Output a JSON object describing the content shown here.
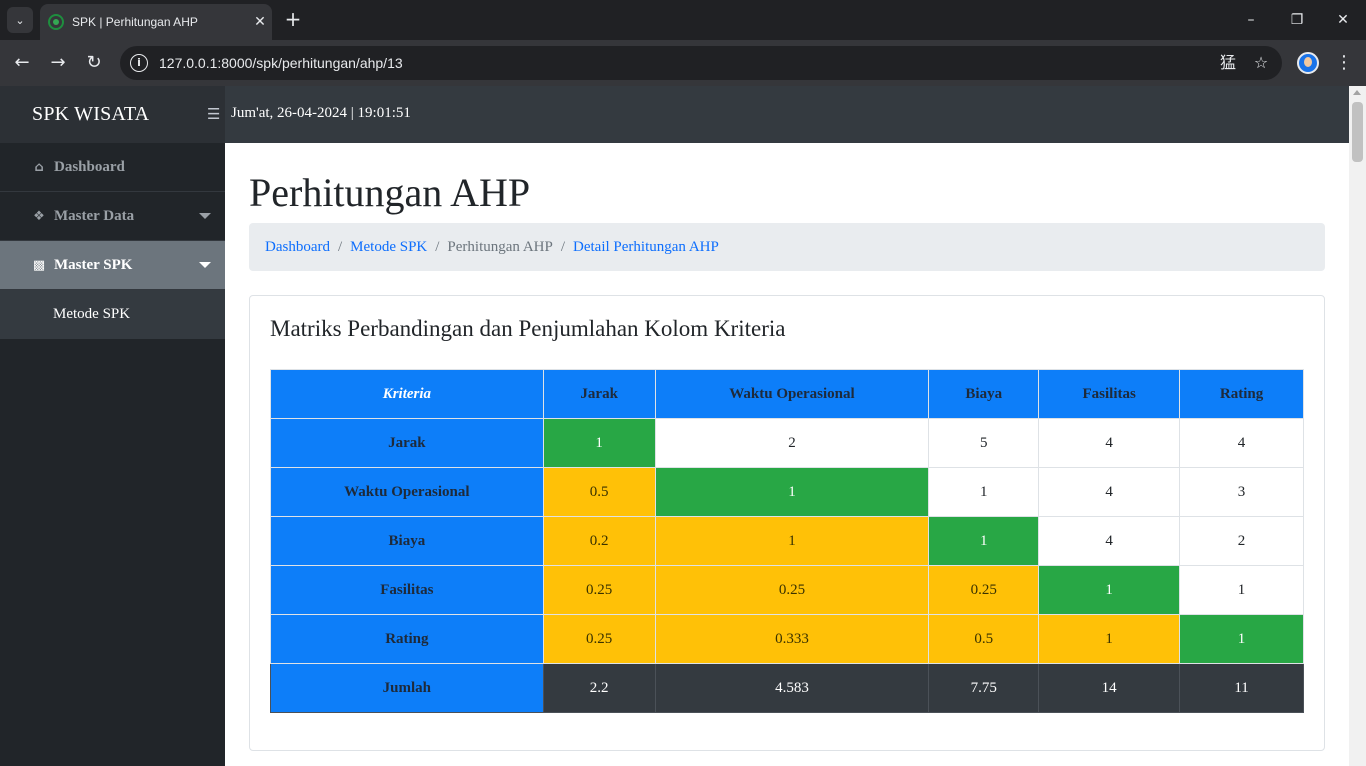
{
  "browser": {
    "tab_title": "SPK | Perhitungan AHP",
    "url": "127.0.0.1:8000/spk/perhitungan/ahp/13",
    "tab_list_icon": "chevron-down-icon",
    "new_tab_icon": "plus-icon"
  },
  "app": {
    "brand": "SPK WISATA",
    "datetime": "Jum'at, 26-04-2024 | 19:01:51"
  },
  "sidebar": {
    "items": [
      {
        "label": "Dashboard",
        "icon": "home-icon"
      },
      {
        "label": "Master Data",
        "icon": "cubes-icon"
      },
      {
        "label": "Master SPK",
        "icon": "sitemap-icon",
        "active": true
      }
    ],
    "sub_items": [
      {
        "label": "Metode SPK"
      }
    ]
  },
  "page": {
    "title": "Perhitungan AHP",
    "breadcrumb": [
      "Dashboard",
      "Metode SPK",
      "Perhitungan AHP",
      "Detail Perhitungan AHP"
    ]
  },
  "card": {
    "title": "Matriks Perbandingan dan Penjumlahan Kolom Kriteria"
  },
  "matrix": {
    "corner_header": "Kriteria",
    "columns": [
      "Jarak",
      "Waktu Operasional",
      "Biaya",
      "Fasilitas",
      "Rating"
    ],
    "rows": [
      {
        "name": "Jarak",
        "values": [
          "1",
          "2",
          "5",
          "4",
          "4"
        ]
      },
      {
        "name": "Waktu Operasional",
        "values": [
          "0.5",
          "1",
          "1",
          "4",
          "3"
        ]
      },
      {
        "name": "Biaya",
        "values": [
          "0.2",
          "1",
          "1",
          "4",
          "2"
        ]
      },
      {
        "name": "Fasilitas",
        "values": [
          "0.25",
          "0.25",
          "0.25",
          "1",
          "1"
        ]
      },
      {
        "name": "Rating",
        "values": [
          "0.25",
          "0.333",
          "0.5",
          "1",
          "1"
        ]
      }
    ],
    "sum_label": "Jumlah",
    "sums": [
      "2.2",
      "4.583",
      "7.75",
      "14",
      "11"
    ]
  },
  "colors": {
    "header_blue": "#0d7ef9",
    "diagonal_green": "#28a745",
    "lower_yellow": "#ffc107",
    "sum_dark": "#343a40"
  }
}
